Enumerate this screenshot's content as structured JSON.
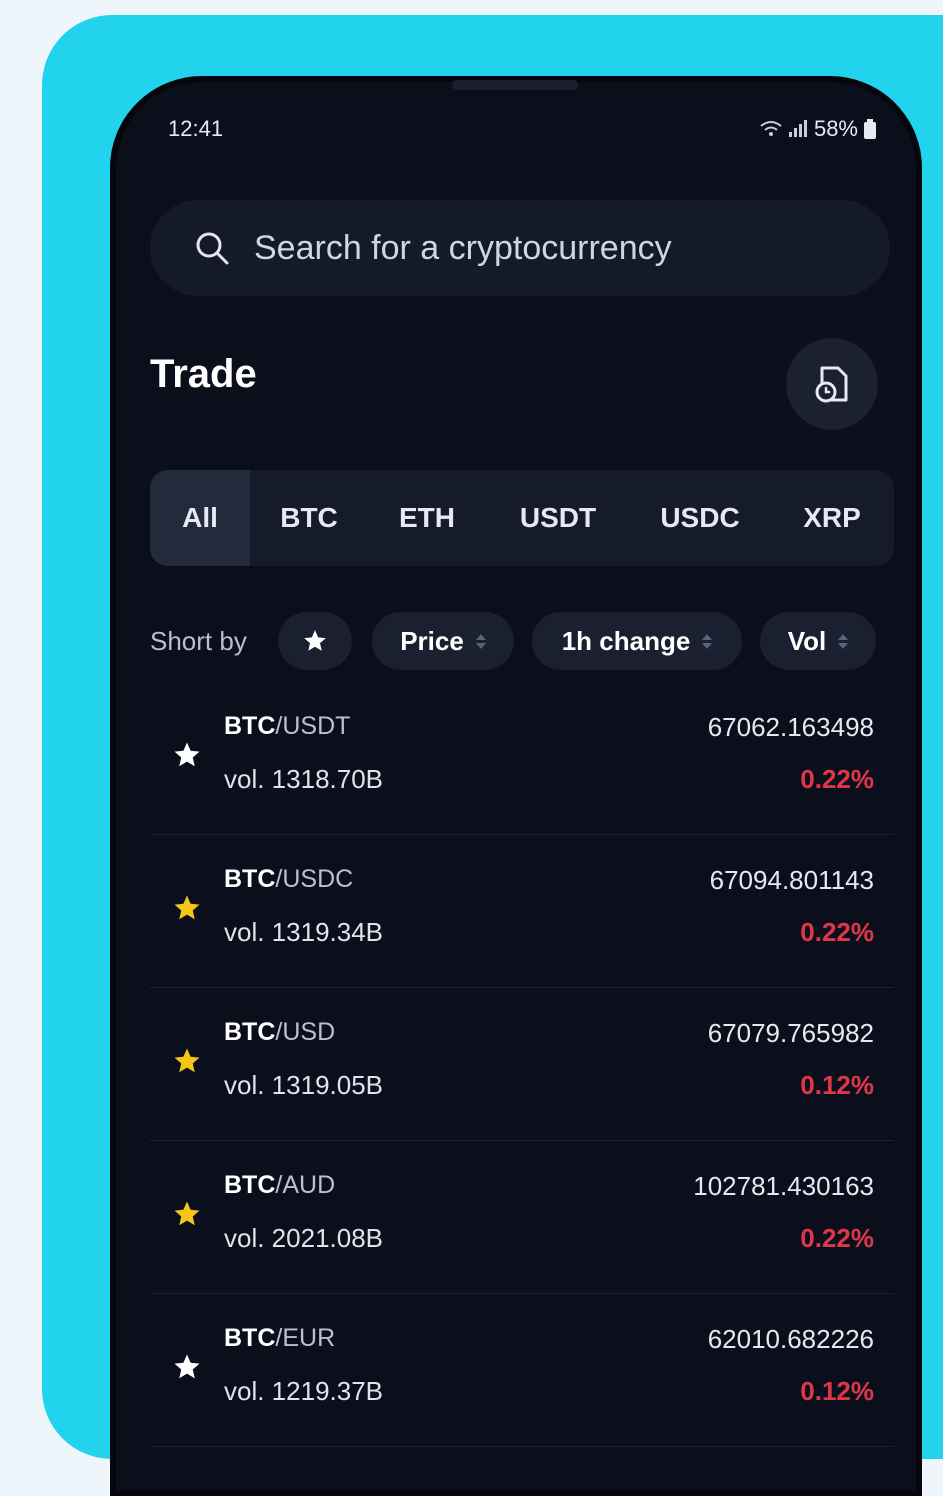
{
  "status_bar": {
    "time": "12:41",
    "battery": "58%"
  },
  "search": {
    "placeholder": "Search for a cryptocurrency"
  },
  "header": {
    "title": "Trade"
  },
  "tabs": [
    {
      "label": "All",
      "active": true
    },
    {
      "label": "BTC",
      "active": false
    },
    {
      "label": "ETH",
      "active": false
    },
    {
      "label": "USDT",
      "active": false
    },
    {
      "label": "USDC",
      "active": false
    },
    {
      "label": "XRP",
      "active": false
    }
  ],
  "sort": {
    "label": "Short by",
    "price_label": "Price",
    "change_label": "1h change",
    "vol_label": "Vol"
  },
  "pairs": [
    {
      "base": "BTC",
      "quote": "USDT",
      "volume": "vol. 1318.70B",
      "price": "67062.163498",
      "change": "0.22%",
      "favorite": false
    },
    {
      "base": "BTC",
      "quote": "USDC",
      "volume": "vol. 1319.34B",
      "price": "67094.801143",
      "change": "0.22%",
      "favorite": true
    },
    {
      "base": "BTC",
      "quote": "USD",
      "volume": "vol. 1319.05B",
      "price": "67079.765982",
      "change": "0.12%",
      "favorite": true
    },
    {
      "base": "BTC",
      "quote": "AUD",
      "volume": "vol. 2021.08B",
      "price": "102781.430163",
      "change": "0.22%",
      "favorite": true
    },
    {
      "base": "BTC",
      "quote": "EUR",
      "volume": "vol. 1219.37B",
      "price": "62010.682226",
      "change": "0.12%",
      "favorite": false
    }
  ],
  "colors": {
    "accent_background": "#22d3ee",
    "app_background": "#0b0f1c",
    "negative_change": "#e0364a",
    "favorite_star": "#f5c518",
    "default_star": "#ffffff"
  },
  "icons": {
    "search": "search-icon",
    "history": "document-clock-icon",
    "star": "star-icon",
    "wifi": "wifi-icon",
    "signal": "signal-icon",
    "battery": "battery-icon"
  }
}
